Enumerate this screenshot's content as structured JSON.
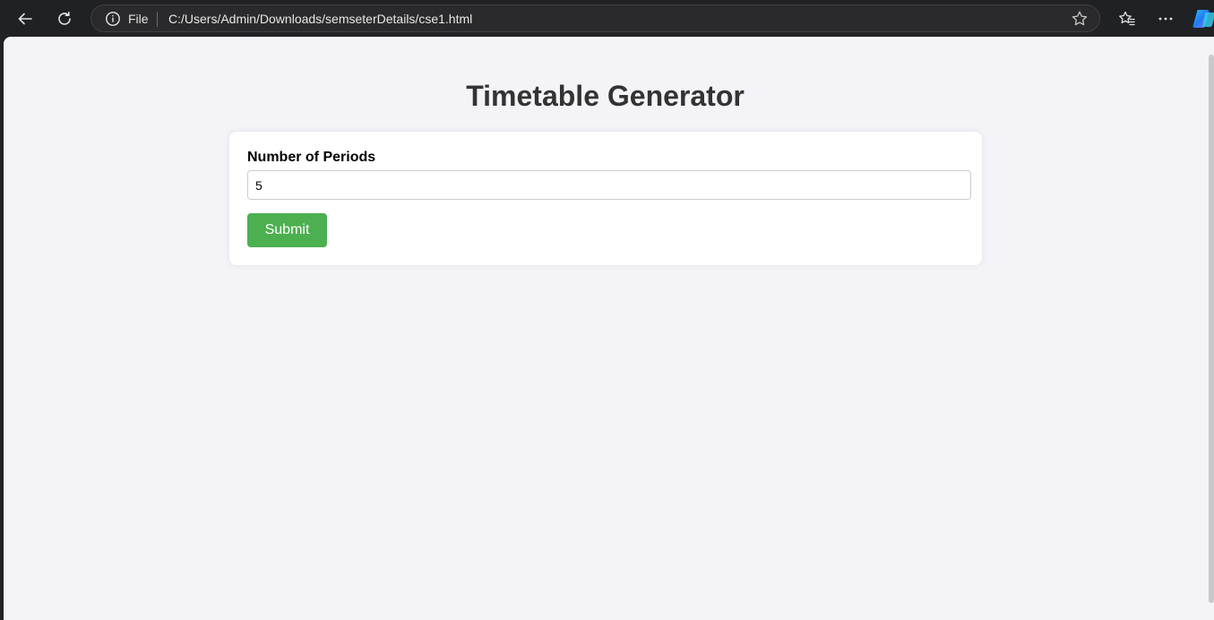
{
  "browser": {
    "address_scheme": "File",
    "url": "C:/Users/Admin/Downloads/semseterDetails/cse1.html",
    "icons": {
      "back": "back-arrow-icon",
      "reload": "reload-icon",
      "info": "info-icon",
      "favorite": "star-icon",
      "favorites": "favorites-icon",
      "more": "more-icon",
      "copilot": "copilot-icon"
    }
  },
  "page": {
    "title": "Timetable Generator",
    "form": {
      "periods_label": "Number of Periods",
      "periods_value": "5",
      "submit_label": "Submit"
    }
  },
  "colors": {
    "page_background": "#f4f4f8",
    "title_text": "#333333",
    "submit_background": "#4caf50",
    "chrome_background": "#202124"
  }
}
